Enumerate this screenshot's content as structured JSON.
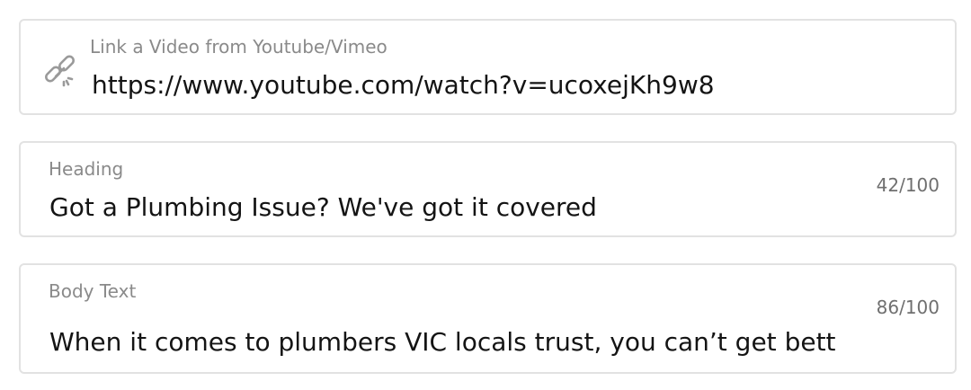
{
  "video_field": {
    "label": "Link a Video from Youtube/Vimeo",
    "value": "https://www.youtube.com/watch?v=ucoxejKh9w8",
    "icon": "link-icon"
  },
  "heading_field": {
    "label": "Heading",
    "value": "Got a Plumbing Issue? We've got it covered",
    "counter": "42/100"
  },
  "body_field": {
    "label": "Body Text",
    "value": "When it comes to plumbers VIC locals trust, you can’t get bett",
    "counter": "86/100"
  },
  "colors": {
    "border": "#e2e2e2",
    "label": "#8a8a8a",
    "value": "#141414",
    "counter": "#6f6f6f"
  }
}
